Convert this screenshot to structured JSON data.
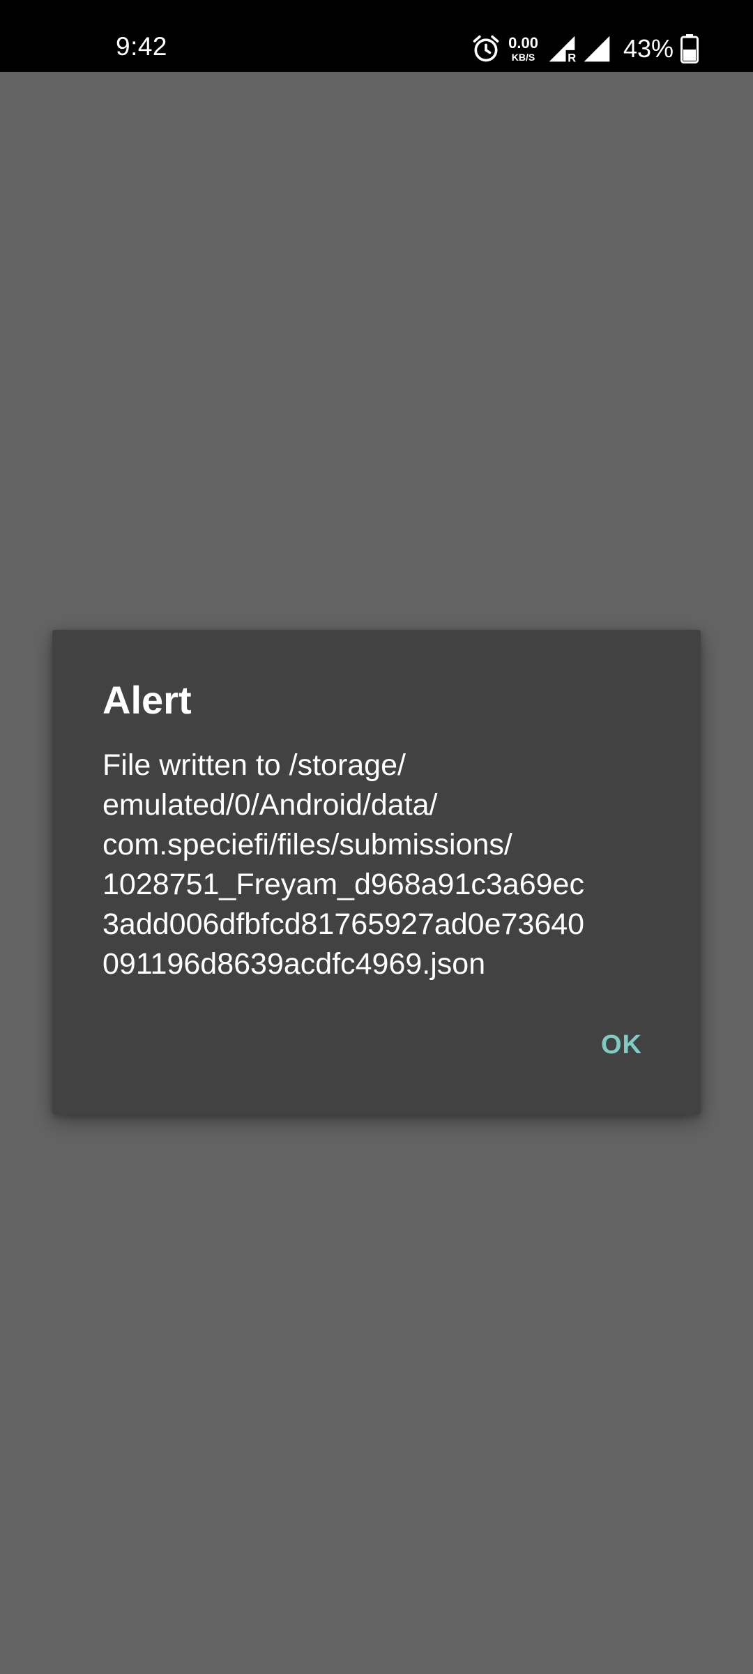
{
  "status_bar": {
    "time": "9:42",
    "net_speed_value": "0.00",
    "net_speed_unit": "KB/S",
    "roaming_indicator": "R",
    "battery_percent": "43%",
    "icons": [
      "alarm-icon",
      "signal-roaming-icon",
      "signal-icon",
      "battery-icon"
    ]
  },
  "dialog": {
    "title": "Alert",
    "message_lines": [
      "File written to /storage/",
      "emulated/0/Android/data/",
      "com.speciefi/files/submissions/",
      "1028751_Freyam_d968a91c3a69ec",
      "3add006dfbfcd81765927ad0e73640",
      "091196d8639acdfc4969.json"
    ],
    "ok_label": "OK"
  },
  "colors": {
    "scrim": "#646464",
    "dialog_bg": "#424242",
    "accent": "#80cbc4",
    "status_bar": "#000000"
  }
}
